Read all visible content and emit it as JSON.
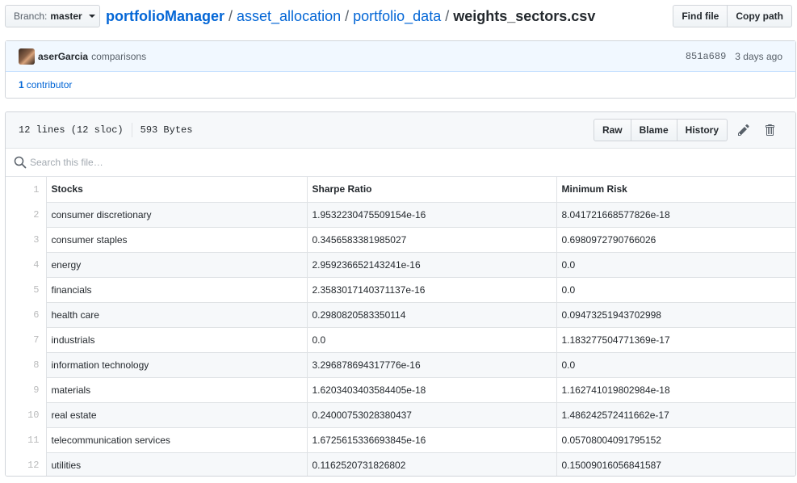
{
  "branch": {
    "prefix": "Branch:",
    "name": "master"
  },
  "breadcrumb": {
    "repo": "portfolioManager",
    "path1": "asset_allocation",
    "path2": "portfolio_data",
    "file": "weights_sectors.csv",
    "separator": "/"
  },
  "top_buttons": {
    "find_file": "Find file",
    "copy_path": "Copy path"
  },
  "commit": {
    "author": "aserGarcia",
    "message": "comparisons",
    "sha": "851a689",
    "time": "3 days ago"
  },
  "contributors": {
    "count": "1",
    "label": "contributor"
  },
  "file": {
    "lines": "12 lines (12 sloc)",
    "size": "593 Bytes",
    "buttons": {
      "raw": "Raw",
      "blame": "Blame",
      "history": "History"
    },
    "search_placeholder": "Search this file…"
  },
  "table": {
    "rows": [
      {
        "n": "1",
        "a": "Stocks",
        "b": "Sharpe Ratio",
        "c": "Minimum Risk"
      },
      {
        "n": "2",
        "a": "consumer discretionary",
        "b": "1.9532230475509154e-16",
        "c": "8.041721668577826e-18"
      },
      {
        "n": "3",
        "a": "consumer staples",
        "b": "0.3456583381985027",
        "c": "0.6980972790766026"
      },
      {
        "n": "4",
        "a": "energy",
        "b": "2.959236652143241e-16",
        "c": "0.0"
      },
      {
        "n": "5",
        "a": "financials",
        "b": "2.3583017140371137e-16",
        "c": "0.0"
      },
      {
        "n": "6",
        "a": "health care",
        "b": "0.2980820583350114",
        "c": "0.09473251943702998"
      },
      {
        "n": "7",
        "a": "industrials",
        "b": "0.0",
        "c": "1.183277504771369e-17"
      },
      {
        "n": "8",
        "a": "information technology",
        "b": "3.296878694317776e-16",
        "c": "0.0"
      },
      {
        "n": "9",
        "a": "materials",
        "b": "1.6203403403584405e-18",
        "c": "1.162741019802984e-18"
      },
      {
        "n": "10",
        "a": "real estate",
        "b": "0.24000753028380437",
        "c": "1.486242572411662e-17"
      },
      {
        "n": "11",
        "a": "telecommunication services",
        "b": "1.6725615336693845e-16",
        "c": "0.05708004091795152"
      },
      {
        "n": "12",
        "a": "utilities",
        "b": "0.1162520731826802",
        "c": "0.15009016056841587"
      }
    ]
  }
}
